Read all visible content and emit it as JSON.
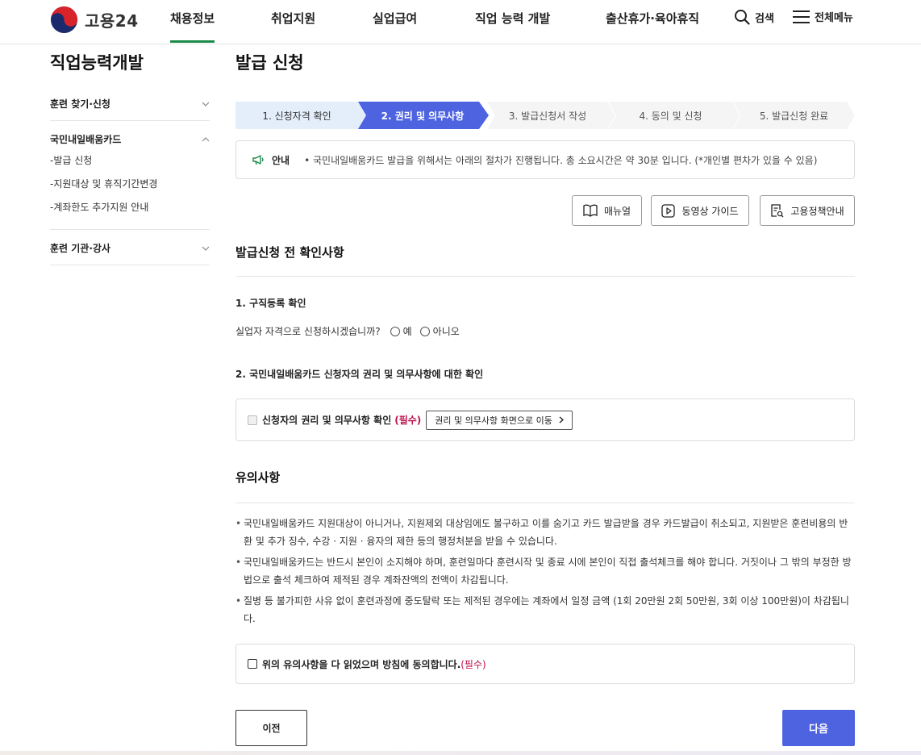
{
  "header": {
    "logo_text": "고용24",
    "nav": [
      {
        "label": "채용정보",
        "active": true
      },
      {
        "label": "취업지원"
      },
      {
        "label": "실업급여"
      },
      {
        "label": "직업 능력 개발"
      },
      {
        "label": "출산휴가·육아휴직"
      }
    ],
    "search_label": "검색",
    "menu_label": "전체메뉴"
  },
  "sidebar": {
    "title": "직업능력개발",
    "groups": [
      {
        "label": "훈련 찾기·신청",
        "expanded": false,
        "items": []
      },
      {
        "label": "국민내일배움카드",
        "expanded": true,
        "items": [
          {
            "label": "-발급 신청"
          },
          {
            "label": "-지원대상 및 휴직기간변경"
          },
          {
            "label": "-계좌한도 추가지원 안내"
          }
        ]
      },
      {
        "label": "훈련 기관·강사",
        "expanded": false,
        "items": []
      }
    ]
  },
  "main": {
    "title": "발급 신청",
    "steps": [
      {
        "label": "1. 신청자격 확인",
        "state": "done"
      },
      {
        "label": "2. 권리 및 의무사항",
        "state": "current"
      },
      {
        "label": "3. 발급신청서 작성",
        "state": "todo"
      },
      {
        "label": "4. 동의 및 신청",
        "state": "todo"
      },
      {
        "label": "5. 발급신청 완료",
        "state": "todo"
      }
    ],
    "notice": {
      "label": "안내",
      "text": "• 국민내일배움카드 발급을 위해서는 아래의 절차가 진행됩니다. 총 소요시간은 약 30분 입니다. (*개인별 편차가 있을 수 있음)"
    },
    "guide_buttons": {
      "manual": "매뉴얼",
      "video": "동영상 가이드",
      "policy": "고용정책안내"
    },
    "section1_title": "발급신청 전 확인사항",
    "q1": {
      "title": "1. 구직등록 확인",
      "question": "실업자 자격으로 신청하시겠습니까?",
      "yes": "예",
      "no": "아니오"
    },
    "q2": {
      "title": "2. 국민내일배움카드 신청자의 권리 및 의무사항에 대한 확인",
      "check_label": "신청자의 권리 및 의무사항 확인",
      "required": "(필수)",
      "link_button": "권리 및 의무사항 화면으로 이동"
    },
    "section2_title": "유의사항",
    "cautions": [
      {
        "line1": "국민내일배움카드 지원대상이 아니거나, 지원제외 대상임에도 불구하고 이를 숨기고 카드 발급받을 경우 카드발급이 취소되고, 지원받은 훈련비용의 반",
        "line2": "환 및 추가 징수, 수강 · 지원 · 융자의 제한 등의 행정처분을 받을 수 있습니다."
      },
      {
        "line1": "국민내일배움카드는 반드시 본인이 소지해야 하며, 훈련일마다 훈련시작 및 종료 시에 본인이 직접 출석체크를 해야 합니다. 거짓이나 그 밖의 부정한 방",
        "line2": "법으로 출석 체크하여 제적된 경우 계좌잔액의 전액이 차감됩니다."
      },
      {
        "line1": "질병 등 불가피한 사유 없이 훈련과정에 중도탈락 또는 제적된 경우에는 계좌에서 일정 금액 (1회 20만원 2회 50만원, 3회 이상 100만원)이 차감됩니",
        "line2": "다."
      }
    ],
    "agree": {
      "label": "위의 유의사항을 다 읽었으며 방침에 동의합니다.",
      "required": "(필수)"
    },
    "prev_button": "이전",
    "next_button": "다음"
  },
  "colors": {
    "accent_green": "#1a8a4a",
    "step_current": "#4e63e0",
    "step_done": "#e4eefb",
    "step_todo": "#f5f5f5",
    "required_red": "#c0114d",
    "next_button": "#4e63e0"
  }
}
